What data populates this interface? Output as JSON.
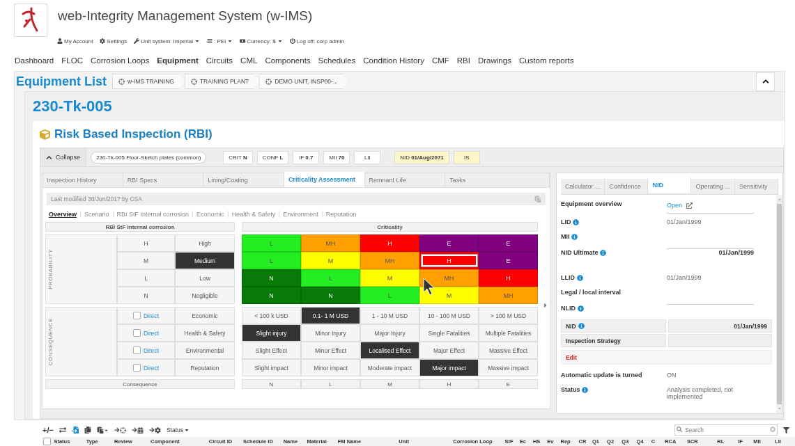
{
  "app": {
    "title": "web-Integrity Management System (w-IMS)"
  },
  "account_bar": [
    {
      "label": "My Account",
      "dropdown": false
    },
    {
      "label": "Settings",
      "dropdown": false
    },
    {
      "label": "Unit system: Imperial",
      "dropdown": true
    },
    {
      "label": ": PEI",
      "dropdown": true
    },
    {
      "label": "Currency: $",
      "dropdown": true
    },
    {
      "label": "Log off: corp admin",
      "dropdown": false
    }
  ],
  "nav": [
    {
      "label": "Dashboard",
      "selected": false
    },
    {
      "label": "FLOC",
      "selected": false
    },
    {
      "label": "Corrosion Loops",
      "selected": false
    },
    {
      "label": "Equipment",
      "selected": true
    },
    {
      "label": "Circuits",
      "selected": false
    },
    {
      "label": "CML",
      "selected": false
    },
    {
      "label": "Components",
      "selected": false
    },
    {
      "label": "Schedules",
      "selected": false
    },
    {
      "label": "Condition History",
      "selected": false
    },
    {
      "label": "CMF",
      "selected": false
    },
    {
      "label": "RBI",
      "selected": false
    },
    {
      "label": "Drawings",
      "selected": false
    },
    {
      "label": "Custom reports",
      "selected": false
    }
  ],
  "page_title": "Equipment List",
  "breadcrumbs": [
    "w-IMS TRAINING",
    "TRAINING PLANT",
    "DEMO UNIT, INSP00-..."
  ],
  "equipment_id": "230-Tk-005",
  "section_title": "Risk Based Inspection (RBI)",
  "toolbar": {
    "collapse": "Collapse",
    "component": "230-Tk-005 Floor-Sketch plates (common)",
    "badges": [
      {
        "label": "CRIT",
        "value": "N",
        "highlighted": false
      },
      {
        "label": "CONF",
        "value": "L",
        "highlighted": false
      },
      {
        "label": "IF",
        "value": "0.7",
        "highlighted": false
      },
      {
        "label": "MII",
        "value": "70",
        "highlighted": false
      },
      {
        "label": "LII",
        "highlighted": false
      },
      {
        "label": "NID",
        "value": "01/Aug/2071",
        "highlighted": true
      },
      {
        "label": "IS",
        "highlighted": true
      }
    ]
  },
  "left_tabs": [
    {
      "label": "Inspection History",
      "selected": false
    },
    {
      "label": "RBI Specs",
      "selected": false
    },
    {
      "label": "Lining/Coating",
      "selected": false
    },
    {
      "label": "Criticality Assessment",
      "selected": true
    },
    {
      "label": "Remnant Life",
      "selected": false
    },
    {
      "label": "Tasks",
      "selected": false
    }
  ],
  "last_modified": "Last modified 30/Jun/2017 by CSA",
  "sub_tabs": [
    {
      "label": "Overview",
      "selected": true
    },
    {
      "label": "Scenario",
      "selected": false
    },
    {
      "label": "RBI StF Internal corrosion",
      "selected": false
    },
    {
      "label": "Economic",
      "selected": false
    },
    {
      "label": "Health & Safety",
      "selected": false
    },
    {
      "label": "Environment",
      "selected": false
    },
    {
      "label": "Reputation",
      "selected": false
    }
  ],
  "matrix": {
    "probability_header": "RBI StF Internal corrosion",
    "probability_axis": "PROBABILITY",
    "criticality_header": "Criticality",
    "probability_rows": [
      {
        "code": "H",
        "label": "High",
        "selected": false,
        "cells": [
          {
            "value": "L",
            "color": "#22ee22",
            "selected": false
          },
          {
            "value": "MH",
            "color": "#ff9f00",
            "selected": false
          },
          {
            "value": "H",
            "color": "#ff0000",
            "selected": false
          },
          {
            "value": "E",
            "color": "#800080",
            "selected": false
          },
          {
            "value": "E",
            "color": "#800080",
            "selected": false
          }
        ]
      },
      {
        "code": "M",
        "label": "Medium",
        "selected": true,
        "cells": [
          {
            "value": "L",
            "color": "#22ee22",
            "selected": false
          },
          {
            "value": "M",
            "color": "#ffff00",
            "selected": false
          },
          {
            "value": "MH",
            "color": "#ff9f00",
            "selected": false
          },
          {
            "value": "H",
            "color": "#ff0000",
            "selected": true
          },
          {
            "value": "E",
            "color": "#800080",
            "selected": false
          }
        ]
      },
      {
        "code": "L",
        "label": "Low",
        "selected": false,
        "cells": [
          {
            "value": "N",
            "color": "#087a08",
            "selected": false
          },
          {
            "value": "L",
            "color": "#22ee22",
            "selected": false
          },
          {
            "value": "M",
            "color": "#ffff00",
            "selected": false
          },
          {
            "value": "MH",
            "color": "#ff9f00",
            "selected": false
          },
          {
            "value": "H",
            "color": "#ff0000",
            "selected": false
          }
        ]
      },
      {
        "code": "N",
        "label": "Negligible",
        "selected": false,
        "cells": [
          {
            "value": "N",
            "color": "#087a08",
            "selected": false
          },
          {
            "value": "N",
            "color": "#087a08",
            "selected": false
          },
          {
            "value": "L",
            "color": "#22ee22",
            "selected": false
          },
          {
            "value": "M",
            "color": "#ffff00",
            "selected": false
          },
          {
            "value": "MH",
            "color": "#ff9f00",
            "selected": false
          }
        ]
      }
    ],
    "consequence_axis": "CONSEQUENCE",
    "consequence_rows": [
      {
        "checked": false,
        "link": "Direct",
        "label": "Economic",
        "options": [
          {
            "label": "< 100 k USD",
            "selected": false
          },
          {
            "label": "0.1- 1 M USD",
            "selected": true
          },
          {
            "label": "1 - 10 M USD",
            "selected": false
          },
          {
            "label": "10 - 100 M USD",
            "selected": false
          },
          {
            "label": "> 100 M USD",
            "selected": false
          }
        ]
      },
      {
        "checked": false,
        "link": "Direct",
        "label": "Health & Safety",
        "options": [
          {
            "label": "Slight injury",
            "selected": true
          },
          {
            "label": "Minor Injury",
            "selected": false
          },
          {
            "label": "Major Injury",
            "selected": false
          },
          {
            "label": "Single Fatalities",
            "selected": false
          },
          {
            "label": "Multiple Fatalities",
            "selected": false
          }
        ]
      },
      {
        "checked": false,
        "link": "Direct",
        "label": "Environmental",
        "options": [
          {
            "label": "Slight Effect",
            "selected": false
          },
          {
            "label": "Minor Effect",
            "selected": false
          },
          {
            "label": "Localised Effect",
            "selected": true
          },
          {
            "label": "Major Effect",
            "selected": false
          },
          {
            "label": "Massive Effect",
            "selected": false
          }
        ]
      },
      {
        "checked": false,
        "link": "Direct",
        "label": "Reputation",
        "options": [
          {
            "label": "Slight impact",
            "selected": false
          },
          {
            "label": "Minor impact",
            "selected": false
          },
          {
            "label": "Moderate impact",
            "selected": false
          },
          {
            "label": "Major impact",
            "selected": true
          },
          {
            "label": "Massive impact",
            "selected": false
          }
        ]
      }
    ],
    "consequence_footer": "Consequence",
    "consequence_levels": [
      "N",
      "L",
      "M",
      "H",
      "E"
    ]
  },
  "right_tabs": [
    {
      "label": "Calculator ...",
      "selected": false
    },
    {
      "label": "Confidence",
      "selected": false
    },
    {
      "label": "NID",
      "selected": true
    },
    {
      "label": "Operating ...",
      "selected": false
    },
    {
      "label": "Sensitivity",
      "selected": false
    }
  ],
  "nid_fields": [
    {
      "kind": "link",
      "label": "Equipment overview",
      "info": false,
      "value": "Open"
    },
    {
      "kind": "text",
      "label": "LID",
      "info": true,
      "value": "01/Jan/1999"
    },
    {
      "kind": "input",
      "label": "MII",
      "info": true
    },
    {
      "kind": "date",
      "label": "NID Ultimate",
      "info": true,
      "value": "01/Jan/1999"
    },
    {
      "kind": "text",
      "label": "LLID",
      "info": true,
      "value": "01/Jan/1999"
    },
    {
      "kind": "input",
      "label": "Legal / local interval",
      "info": false
    },
    {
      "kind": "text",
      "label": "NLID",
      "info": true
    },
    {
      "kind": "boxed",
      "label": "NID",
      "info": true,
      "value": "01/Jan/1999"
    },
    {
      "kind": "boxed",
      "label": "Inspection Strategy",
      "info": false
    },
    {
      "kind": "action",
      "label": "Edit"
    },
    {
      "kind": "text",
      "label": "Automatic update is turned",
      "info": false,
      "value": "ON"
    },
    {
      "kind": "text",
      "label": "Status",
      "info": true,
      "value": "Analysis completed, not implemented"
    }
  ],
  "grid_select_all": {
    "checked": false
  },
  "grid_toolbar": {
    "add_remove": "+/−",
    "status_filter": "Status",
    "search_placeholder": "Search"
  },
  "grid_columns": [
    "Status",
    "Type",
    "Review",
    "Component",
    "Circuit ID",
    "Schedule ID",
    "Name",
    "Material",
    "FM Name",
    "Unit",
    "Corrosion Loop",
    "StF",
    "Ec",
    "HS",
    "Ev",
    "Rep",
    "CR",
    "Q1",
    "Q2",
    "Q3",
    "Q4",
    "C",
    "RCA",
    "SCR",
    "RL",
    "IF",
    "MII",
    "LII"
  ]
}
